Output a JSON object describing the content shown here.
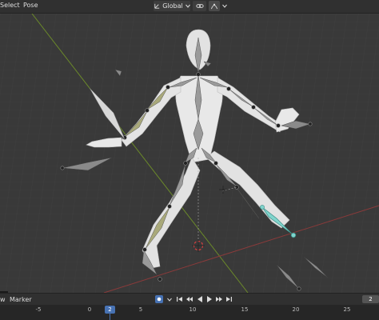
{
  "header": {
    "menu": [
      "Select",
      "Pose"
    ],
    "orientation": "Global"
  },
  "timeline": {
    "view_label": "w",
    "marker_label": "Marker",
    "ticks": [
      "-5",
      "0",
      "5",
      "10",
      "15",
      "20",
      "25"
    ],
    "current_frame": "2",
    "frame_field": "2"
  },
  "icons": {
    "orientation": "global-axes-icon",
    "snap": "link-chain-icon",
    "proportional": "proportional-edit-icon"
  },
  "colors": {
    "viewport_bg": "#393939",
    "x_axis": "#8a3a3a",
    "y_axis": "#6b8a2a",
    "bone_gray": "#9a9a9a",
    "bone_selected": "#a9a97a",
    "bone_active": "#7fd4cc",
    "mesh": "#e6e6e6",
    "accent": "#4772b3"
  }
}
